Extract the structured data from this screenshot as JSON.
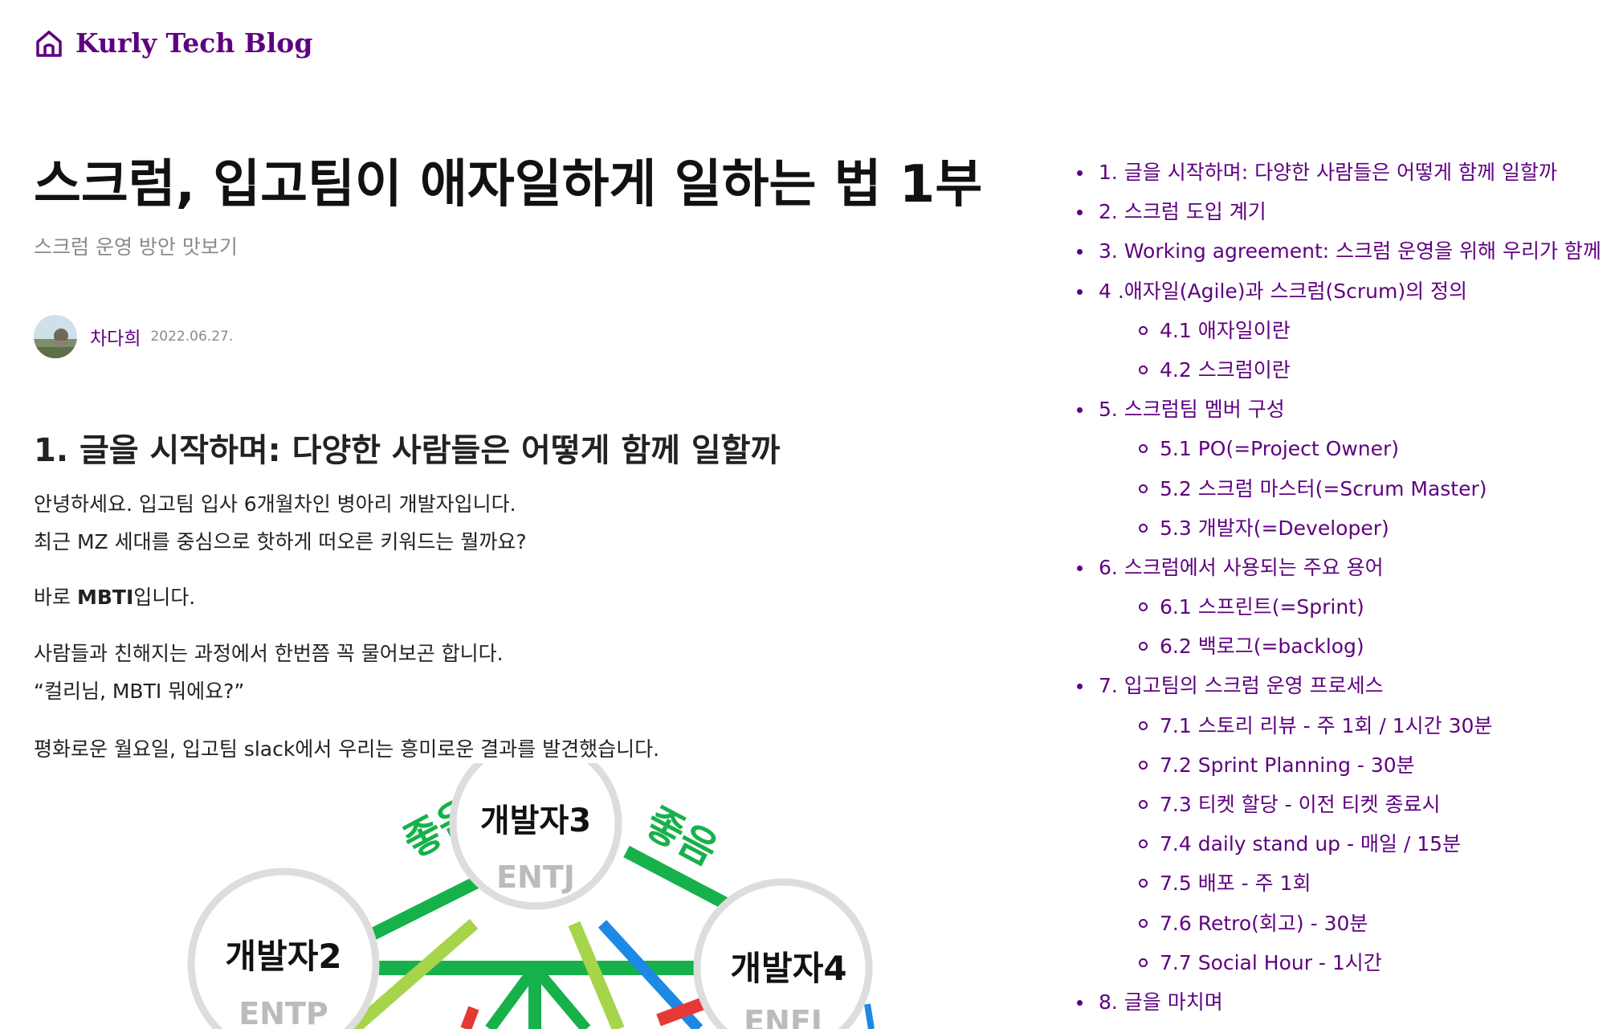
{
  "header": {
    "site_title": "Kurly Tech Blog",
    "icon": "home-icon"
  },
  "post": {
    "title": "스크럼, 입고팀이 애자일하게 일하는 법 1부",
    "subtitle": "스크럼 운영 방안 맛보기",
    "author": "차다희",
    "date": "2022.06.27."
  },
  "section": {
    "heading": "1. 글을 시작하며: 다양한 사람들은 어떻게 함께 일할까",
    "p1_line1": "안녕하세요. 입고팀 입사 6개월차인 병아리 개발자입니다.",
    "p1_line2": "최근 MZ 세대를 중심으로 핫하게 떠오른 키워드는 뭘까요?",
    "p2_prefix": "바로 ",
    "p2_bold": "MBTI",
    "p2_suffix": "입니다.",
    "p3_line1": "사람들과 친해지는 과정에서 한번쯤 꼭 물어보곤 합니다.",
    "p3_line2": "“컬리님, MBTI 뭐에요?”",
    "p4": "평화로운 월요일, 입고팀 slack에서 우리는 흥미로운 결과를 발견했습니다."
  },
  "figure": {
    "good_left": "좋음",
    "good_right": "좋음",
    "node3_name": "개발자3",
    "node3_type": "ENTJ",
    "node2_name": "개발자2",
    "node2_type": "ENTP",
    "node4_name": "개발자4",
    "node4_type": "ENFJ"
  },
  "toc": [
    {
      "label": "1. 글을 시작하며: 다양한 사람들은 어떻게 함께 일할까",
      "level": 1
    },
    {
      "label": "2. 스크럼 도입 계기",
      "level": 1
    },
    {
      "label": "3. Working agreement: 스크럼 운영을 위해 우리가 함께",
      "level": 1
    },
    {
      "label": "4 .애자일(Agile)과 스크럼(Scrum)의 정의",
      "level": 1
    },
    {
      "label": "4.1 애자일이란",
      "level": 2
    },
    {
      "label": "4.2 스크럼이란",
      "level": 2
    },
    {
      "label": "5. 스크럼팀 멤버 구성",
      "level": 1
    },
    {
      "label": "5.1 PO(=Project Owner)",
      "level": 2
    },
    {
      "label": "5.2 스크럼 마스터(=Scrum Master)",
      "level": 2
    },
    {
      "label": "5.3 개발자(=Developer)",
      "level": 2
    },
    {
      "label": "6. 스크럼에서 사용되는 주요 용어",
      "level": 1
    },
    {
      "label": "6.1 스프린트(=Sprint)",
      "level": 2
    },
    {
      "label": "6.2 백로그(=backlog)",
      "level": 2
    },
    {
      "label": "7. 입고팀의 스크럼 운영 프로세스",
      "level": 1
    },
    {
      "label": "7.1 스토리 리뷰 - 주 1회 / 1시간 30분",
      "level": 2
    },
    {
      "label": "7.2 Sprint Planning - 30분",
      "level": 2
    },
    {
      "label": "7.3 티켓 할당 - 이전 티켓 종료시",
      "level": 2
    },
    {
      "label": "7.4 daily stand up - 매일 / 15분",
      "level": 2
    },
    {
      "label": "7.5 배포 - 주 1회",
      "level": 2
    },
    {
      "label": "7.6 Retro(회고) - 30분",
      "level": 2
    },
    {
      "label": "7.7 Social Hour - 1시간",
      "level": 2
    },
    {
      "label": "8. 글을 마치며",
      "level": 1
    }
  ],
  "colors": {
    "brand": "#5f0080",
    "good_green": "#16b14b",
    "light_green": "#a6d44a",
    "blue": "#1e88e5",
    "red": "#e53935"
  }
}
